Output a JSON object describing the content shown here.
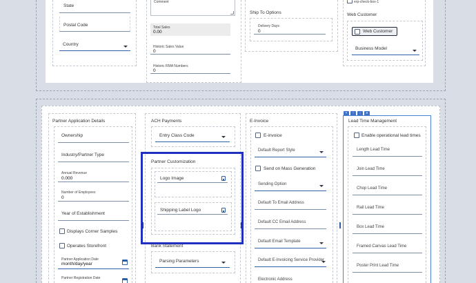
{
  "top": {
    "col1": {
      "state": "State",
      "postal_code": "Postal Code",
      "country": "Country"
    },
    "col2": {
      "comment": "Comment",
      "total_sales_label": "Total Sales",
      "total_sales_value": "0.00",
      "historic_sales_label": "Historic Sales Value",
      "historic_sales_value": "0",
      "historic_rma_label": "Historic RMA Numbers",
      "historic_rma_value": "0"
    },
    "col3": {
      "ship_to_options": "Ship To Options",
      "delivery_days_label": "Delivery Days",
      "delivery_days_value": "0"
    },
    "col4": {
      "erp_checkbox": "erp-check-box-1",
      "web_customer_title": "Web Customer",
      "web_customer_checkbox": "Web Customer",
      "business_model": "Business Model"
    }
  },
  "toolbar": {
    "btn1": "+",
    "btn2": "↑",
    "btn3": "↓",
    "btn4": "≡"
  },
  "partner_app": {
    "title": "Partner Application Details",
    "ownership": "Ownership",
    "industry": "Industry/Partner Type",
    "annual_revenue_label": "Annual Revenue",
    "annual_revenue_value": "0.000",
    "num_employees_label": "Number of Employees",
    "num_employees_value": "0",
    "year_established": "Year of Establishment",
    "displays_corner_samples": "Displays Corner Samples",
    "operates_storefront": "Operates Storefront",
    "app_date_label": "Partner Application Date",
    "app_date_value": "month/day/year",
    "reg_date_label": "Partner Registration Date"
  },
  "ach": {
    "title": "ACH Payments",
    "entry_class_code": "Entry Class Code",
    "partner_customization_title": "Partner Customization",
    "logo_image": "Logo Image",
    "shipping_label_logo": "Shipping Label Logo",
    "bank_statement_title": "Bank Statement",
    "parsing_parameters": "Parsing Parameters"
  },
  "einvoice": {
    "title": "E-Invoice",
    "einvoice_checkbox": "E-invoice",
    "default_report_style": "Default Report Style",
    "send_on_mass": "Send on Mass Generation",
    "sending_option": "Sending Option",
    "default_to_email": "Default To Email Address",
    "default_cc_email": "Default CC Email Address",
    "default_email_template": "Default Email Template",
    "default_einvoicing_provider": "Default E-Invoicing Service Provider",
    "electronic_address": "Electronic Address"
  },
  "lead_time": {
    "title": "Lead Time Management",
    "enable_operational": "Enable operational lead times",
    "items": [
      "Length Lead Time",
      "Join Lead Time",
      "Chop Lead Time",
      "Rail Lead Time",
      "Box Lead Time",
      "Framed Canvas Lead Time",
      "Poster Print Lead Time"
    ]
  },
  "colors": {
    "highlight_border": "#1f2fbf",
    "accent": "#2d5fa8"
  }
}
